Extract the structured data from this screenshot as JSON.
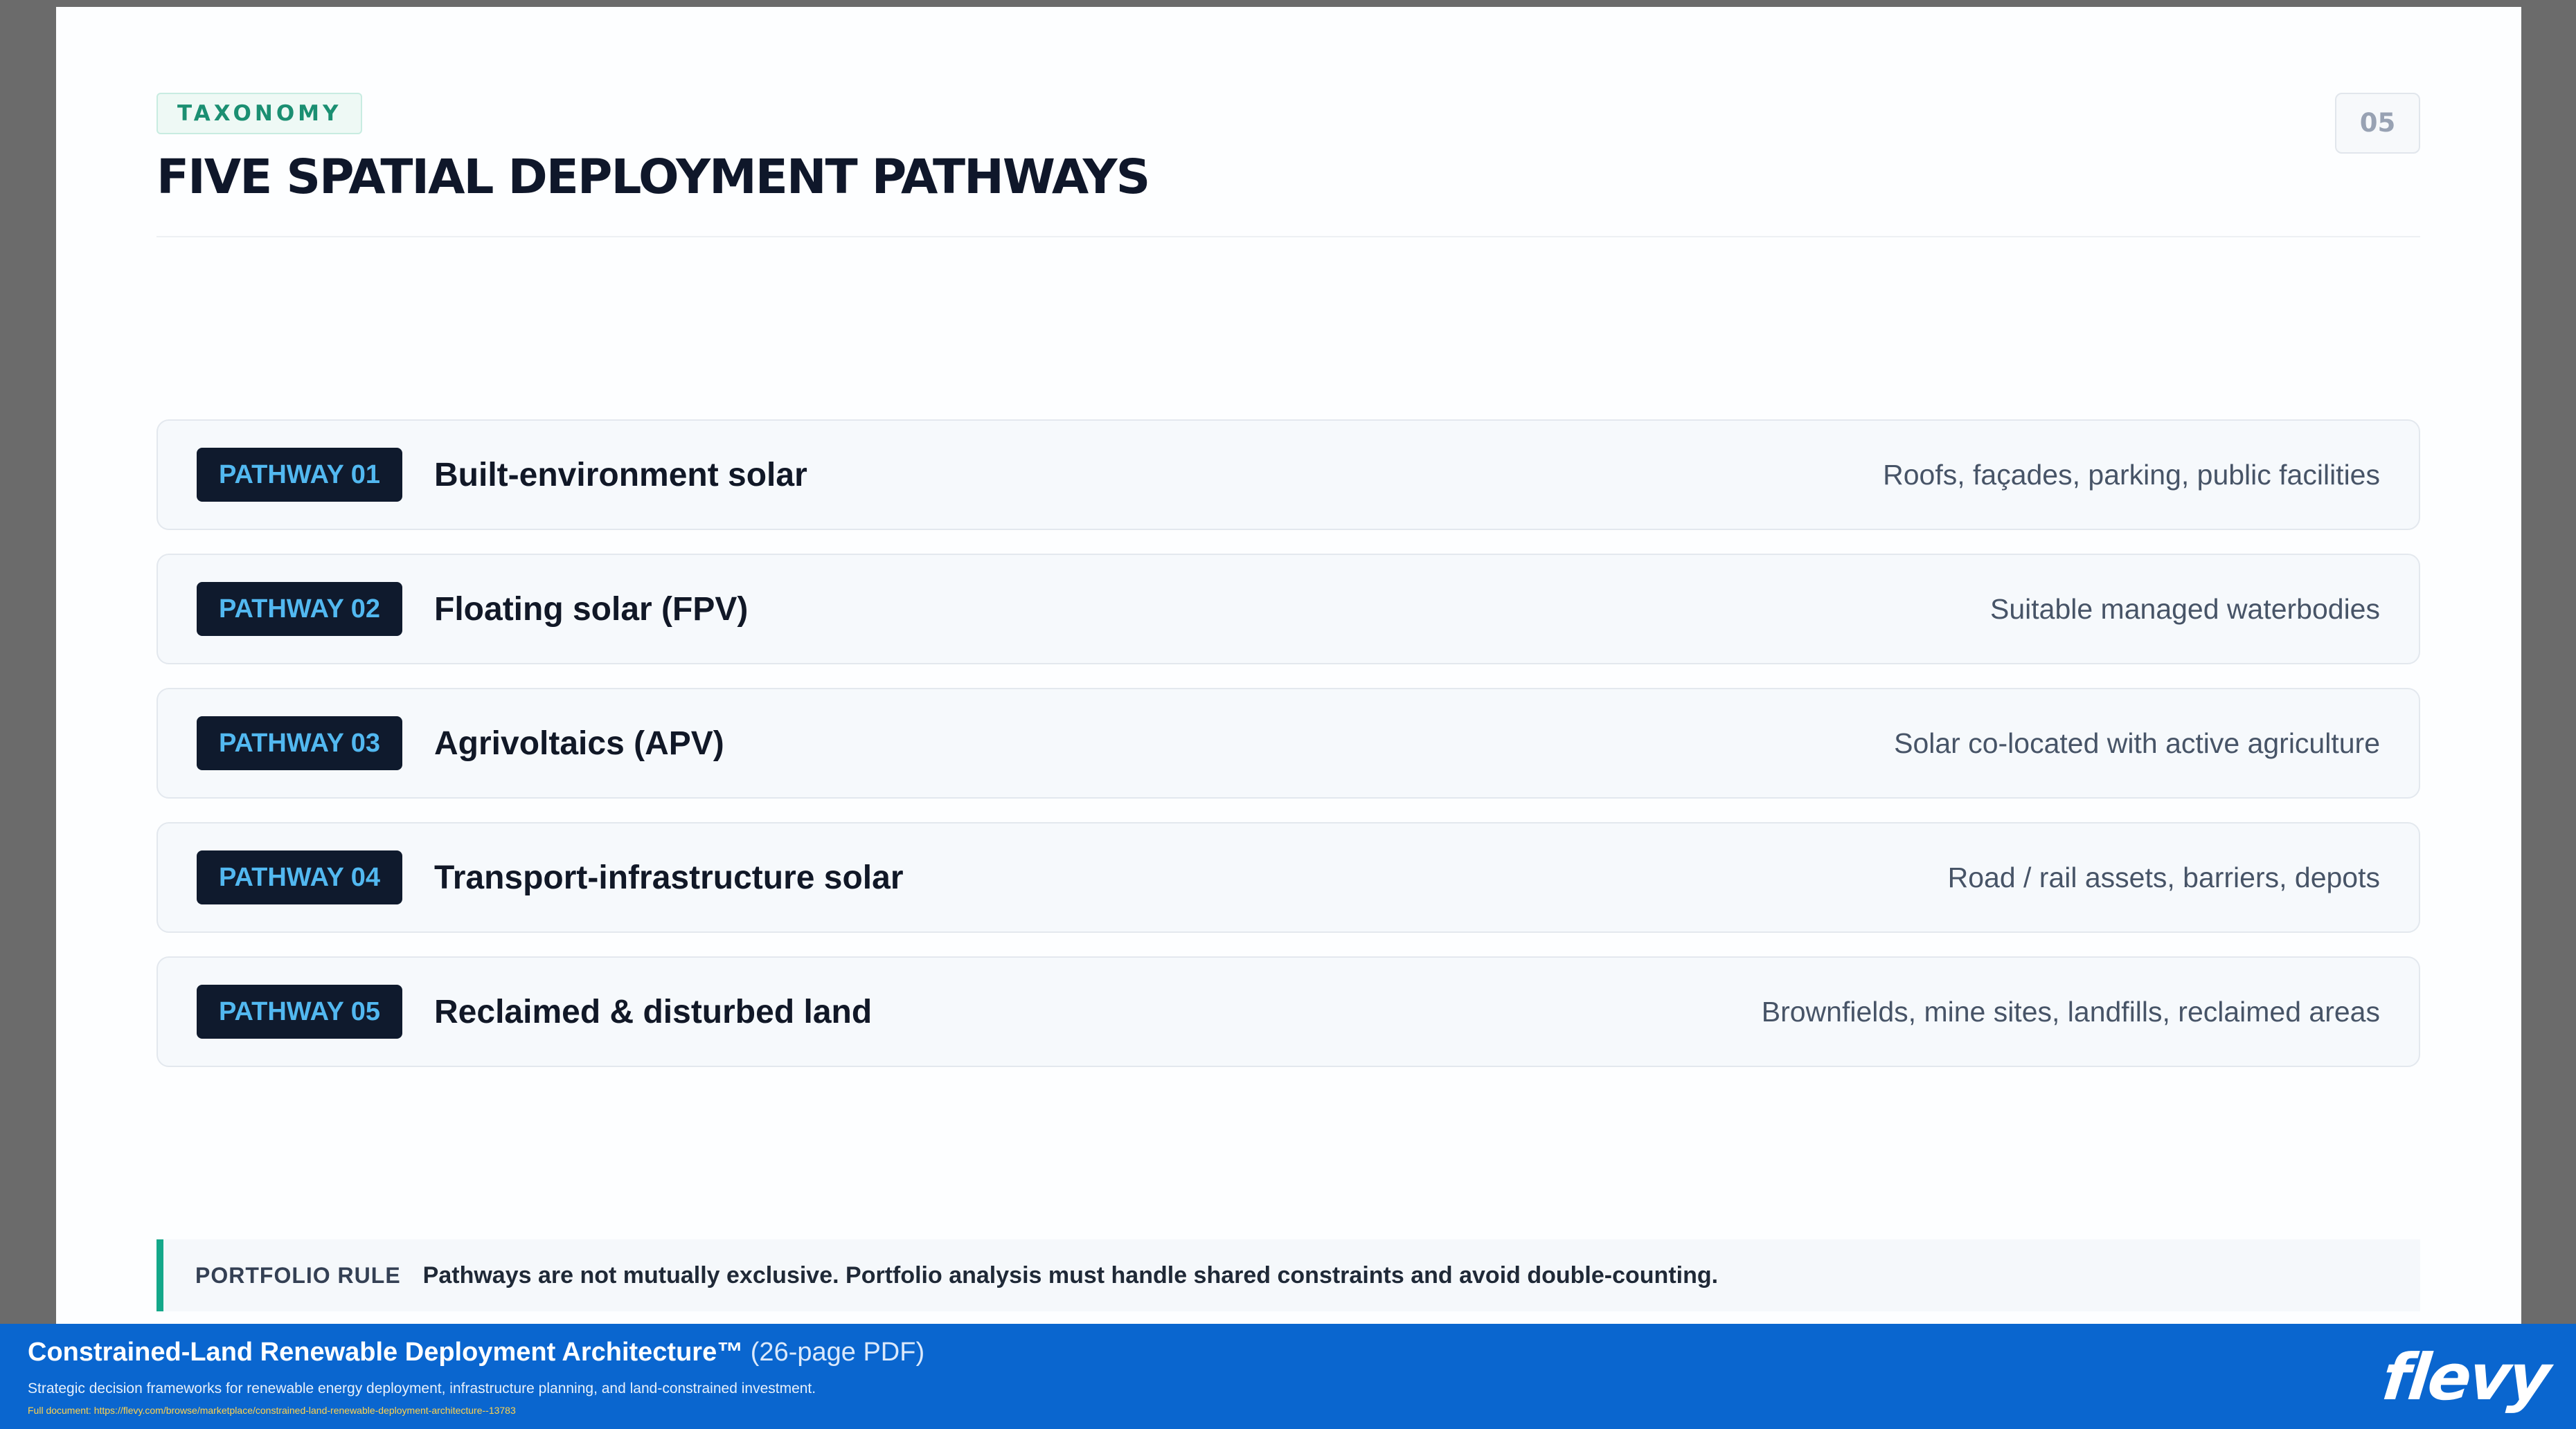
{
  "slide": {
    "tag": "TAXONOMY",
    "title": "FIVE SPATIAL DEPLOYMENT PATHWAYS",
    "page_number": "05"
  },
  "pathways": [
    {
      "badge": "PATHWAY 01",
      "title": "Built-environment solar",
      "description": "Roofs, façades, parking, public facilities"
    },
    {
      "badge": "PATHWAY 02",
      "title": "Floating solar (FPV)",
      "description": "Suitable managed waterbodies"
    },
    {
      "badge": "PATHWAY 03",
      "title": "Agrivoltaics (APV)",
      "description": "Solar co-located with active agriculture"
    },
    {
      "badge": "PATHWAY 04",
      "title": "Transport-infrastructure solar",
      "description": "Road / rail assets, barriers, depots"
    },
    {
      "badge": "PATHWAY 05",
      "title": "Reclaimed & disturbed land",
      "description": "Brownfields, mine sites, landfills, reclaimed areas"
    }
  ],
  "portfolio_rule": {
    "label": "PORTFOLIO RULE",
    "text": "Pathways are not mutually exclusive. Portfolio analysis must handle shared constraints and avoid double-counting."
  },
  "footer": {
    "title": "Constrained-Land Renewable Deployment Architecture™",
    "pages": "(26-page PDF)",
    "subtitle": "Strategic decision frameworks for renewable energy deployment, infrastructure planning, and land-constrained investment.",
    "link": "Full document: https://flevy.com/browse/marketplace/constrained-land-renewable-deployment-architecture--13783",
    "logo": "flevy"
  },
  "colors": {
    "accent_teal": "#14a88a",
    "badge_bg": "#0f1a2d",
    "badge_text": "#52b8f0",
    "footer_blue": "#0a66cf"
  }
}
